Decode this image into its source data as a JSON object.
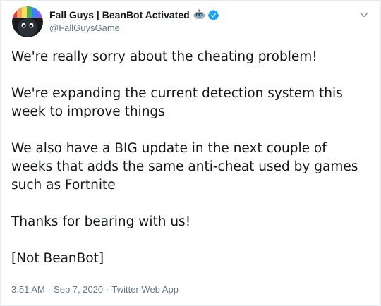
{
  "author": {
    "display_name": "Fall Guys | BeanBot Activated",
    "handle": "@FallGuysGame",
    "emoji_icon": "robot-face-icon",
    "verified_icon": "verified-badge-icon",
    "verified_color": "#1da1f2"
  },
  "tweet": {
    "paragraphs": [
      "We're really sorry about the cheating problem!",
      "We're expanding the current detection system this week to improve things",
      "We also have a BIG update in the next couple of weeks that adds the same anti-cheat used by games such as Fortnite",
      "Thanks for bearing with us!",
      "[Not BeanBot]"
    ],
    "time": "3:51 AM",
    "date": "Sep 7, 2020",
    "separator": "·",
    "source": "Twitter Web App"
  }
}
